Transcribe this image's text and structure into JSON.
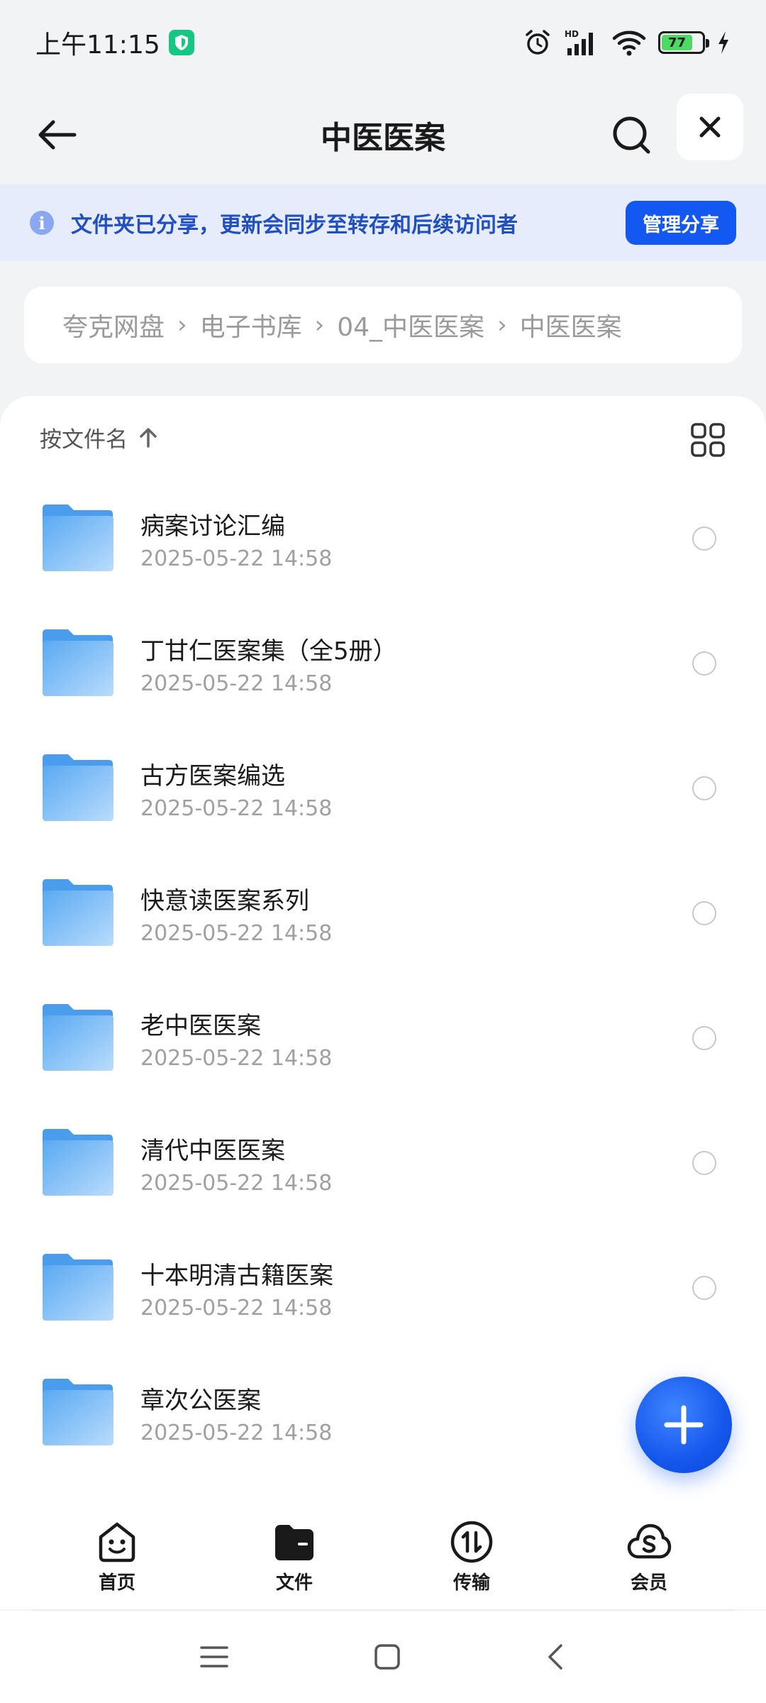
{
  "status": {
    "time": "上午11:15",
    "network": "HD",
    "battery": "77"
  },
  "nav": {
    "title": "中医医案"
  },
  "banner": {
    "text": "文件夹已分享，更新会同步至转存和后续访问者",
    "button": "管理分享"
  },
  "breadcrumb": [
    "夸克网盘",
    "电子书库",
    "04_中医医案",
    "中医医案"
  ],
  "sort": {
    "label": "按文件名"
  },
  "files": [
    {
      "name": "病案讨论汇编",
      "time": "2025-05-22 14:58"
    },
    {
      "name": "丁甘仁医案集（全5册）",
      "time": "2025-05-22 14:58"
    },
    {
      "name": "古方医案编选",
      "time": "2025-05-22 14:58"
    },
    {
      "name": "快意读医案系列",
      "time": "2025-05-22 14:58"
    },
    {
      "name": "老中医医案",
      "time": "2025-05-22 14:58"
    },
    {
      "name": "清代中医医案",
      "time": "2025-05-22 14:58"
    },
    {
      "name": "十本明清古籍医案",
      "time": "2025-05-22 14:58"
    },
    {
      "name": "章次公医案",
      "time": "2025-05-22 14:58"
    }
  ],
  "tabs": [
    {
      "label": "首页",
      "icon": "home-face-icon"
    },
    {
      "label": "文件",
      "icon": "folder-tab-icon"
    },
    {
      "label": "传输",
      "icon": "transfer-icon"
    },
    {
      "label": "会员",
      "icon": "member-cloud-icon"
    }
  ],
  "colors": {
    "accent": "#1358f0",
    "banner_bg": "#e6ecfb",
    "banner_text": "#1f4fc1",
    "folder": "#6cb4f5"
  }
}
